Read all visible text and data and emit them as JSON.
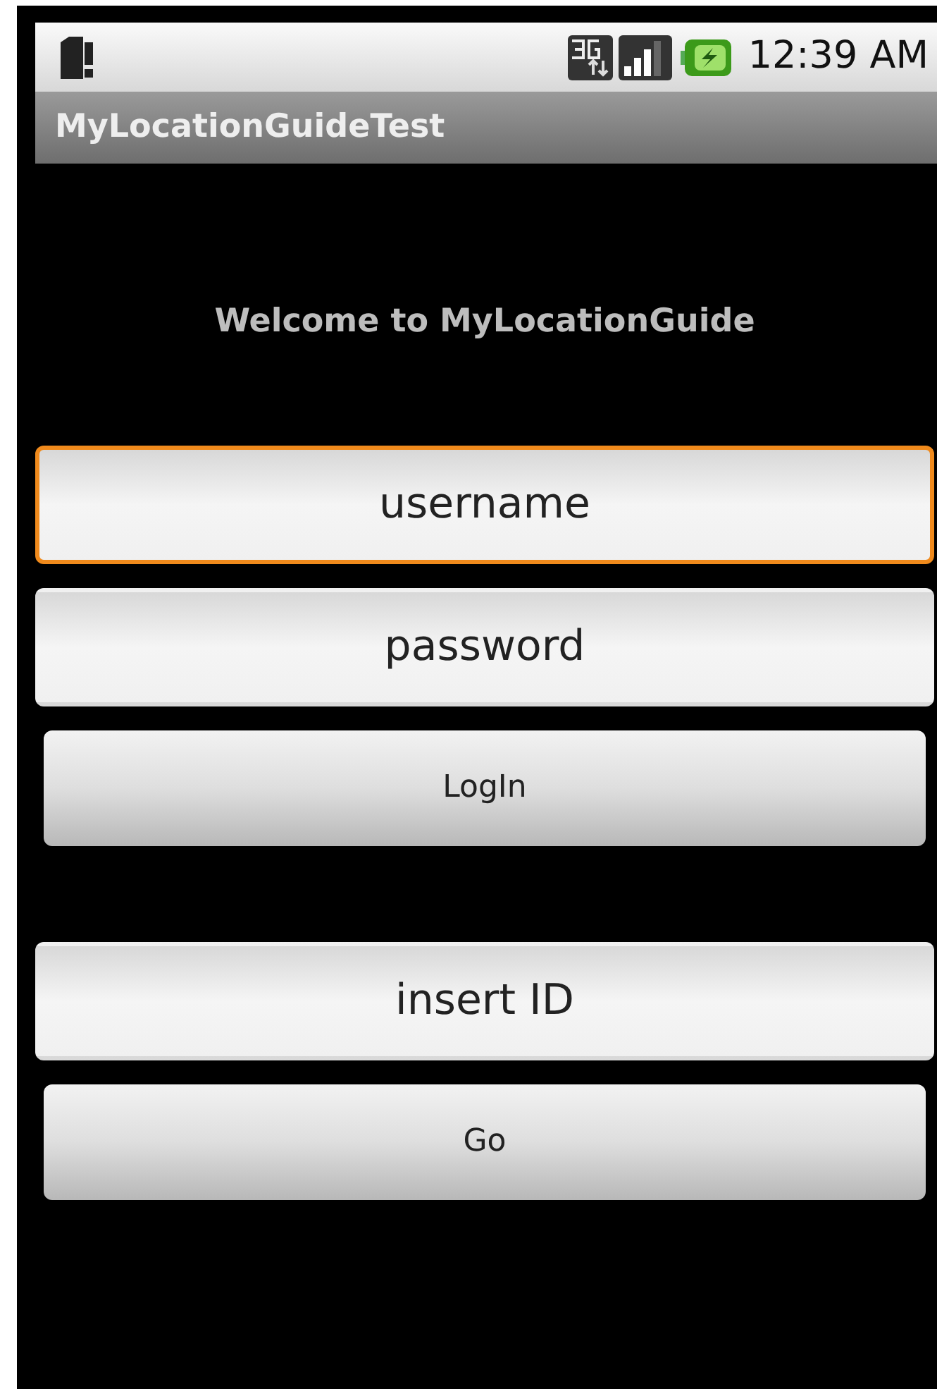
{
  "status_bar": {
    "time": "12:39 AM"
  },
  "title_bar": {
    "title": "MyLocationGuideTest"
  },
  "welcome": "Welcome to MyLocationGuide",
  "controls": [
    {
      "kind": "field",
      "placeholder": "username",
      "focused": true
    },
    {
      "kind": "field",
      "placeholder": "password",
      "focused": false
    },
    {
      "kind": "button",
      "label": "LogIn"
    },
    {
      "kind": "gap"
    },
    {
      "kind": "field",
      "placeholder": "insert ID",
      "focused": false
    },
    {
      "kind": "button",
      "label": "Go"
    }
  ]
}
